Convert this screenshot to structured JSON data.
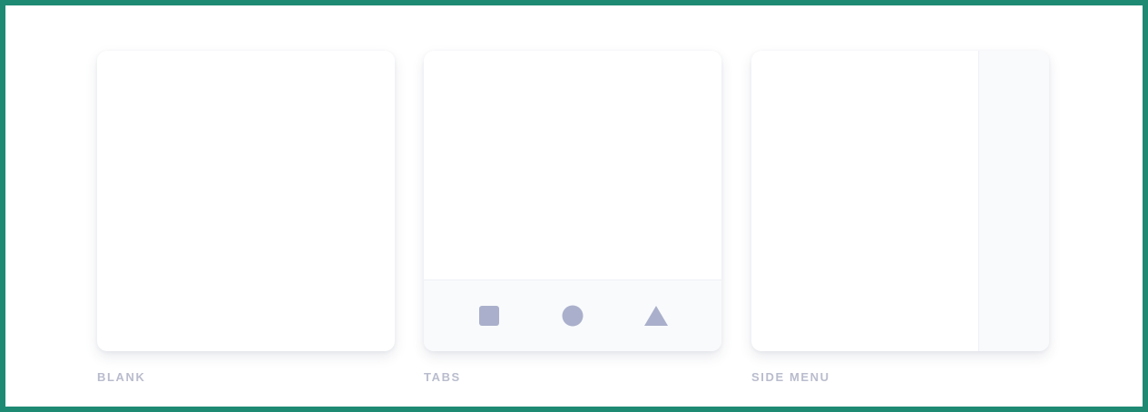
{
  "colors": {
    "frame_border": "#1f8a74",
    "card_background": "#ffffff",
    "panel_background": "#f9fafc",
    "label_color": "#b9bccd",
    "icon_color": "#aab0cb"
  },
  "templates": [
    {
      "id": "blank",
      "label": "BLANK"
    },
    {
      "id": "tabs",
      "label": "TABS",
      "tab_icons": [
        "square-icon",
        "circle-icon",
        "triangle-icon"
      ]
    },
    {
      "id": "sidemenu",
      "label": "SIDE MENU"
    }
  ]
}
